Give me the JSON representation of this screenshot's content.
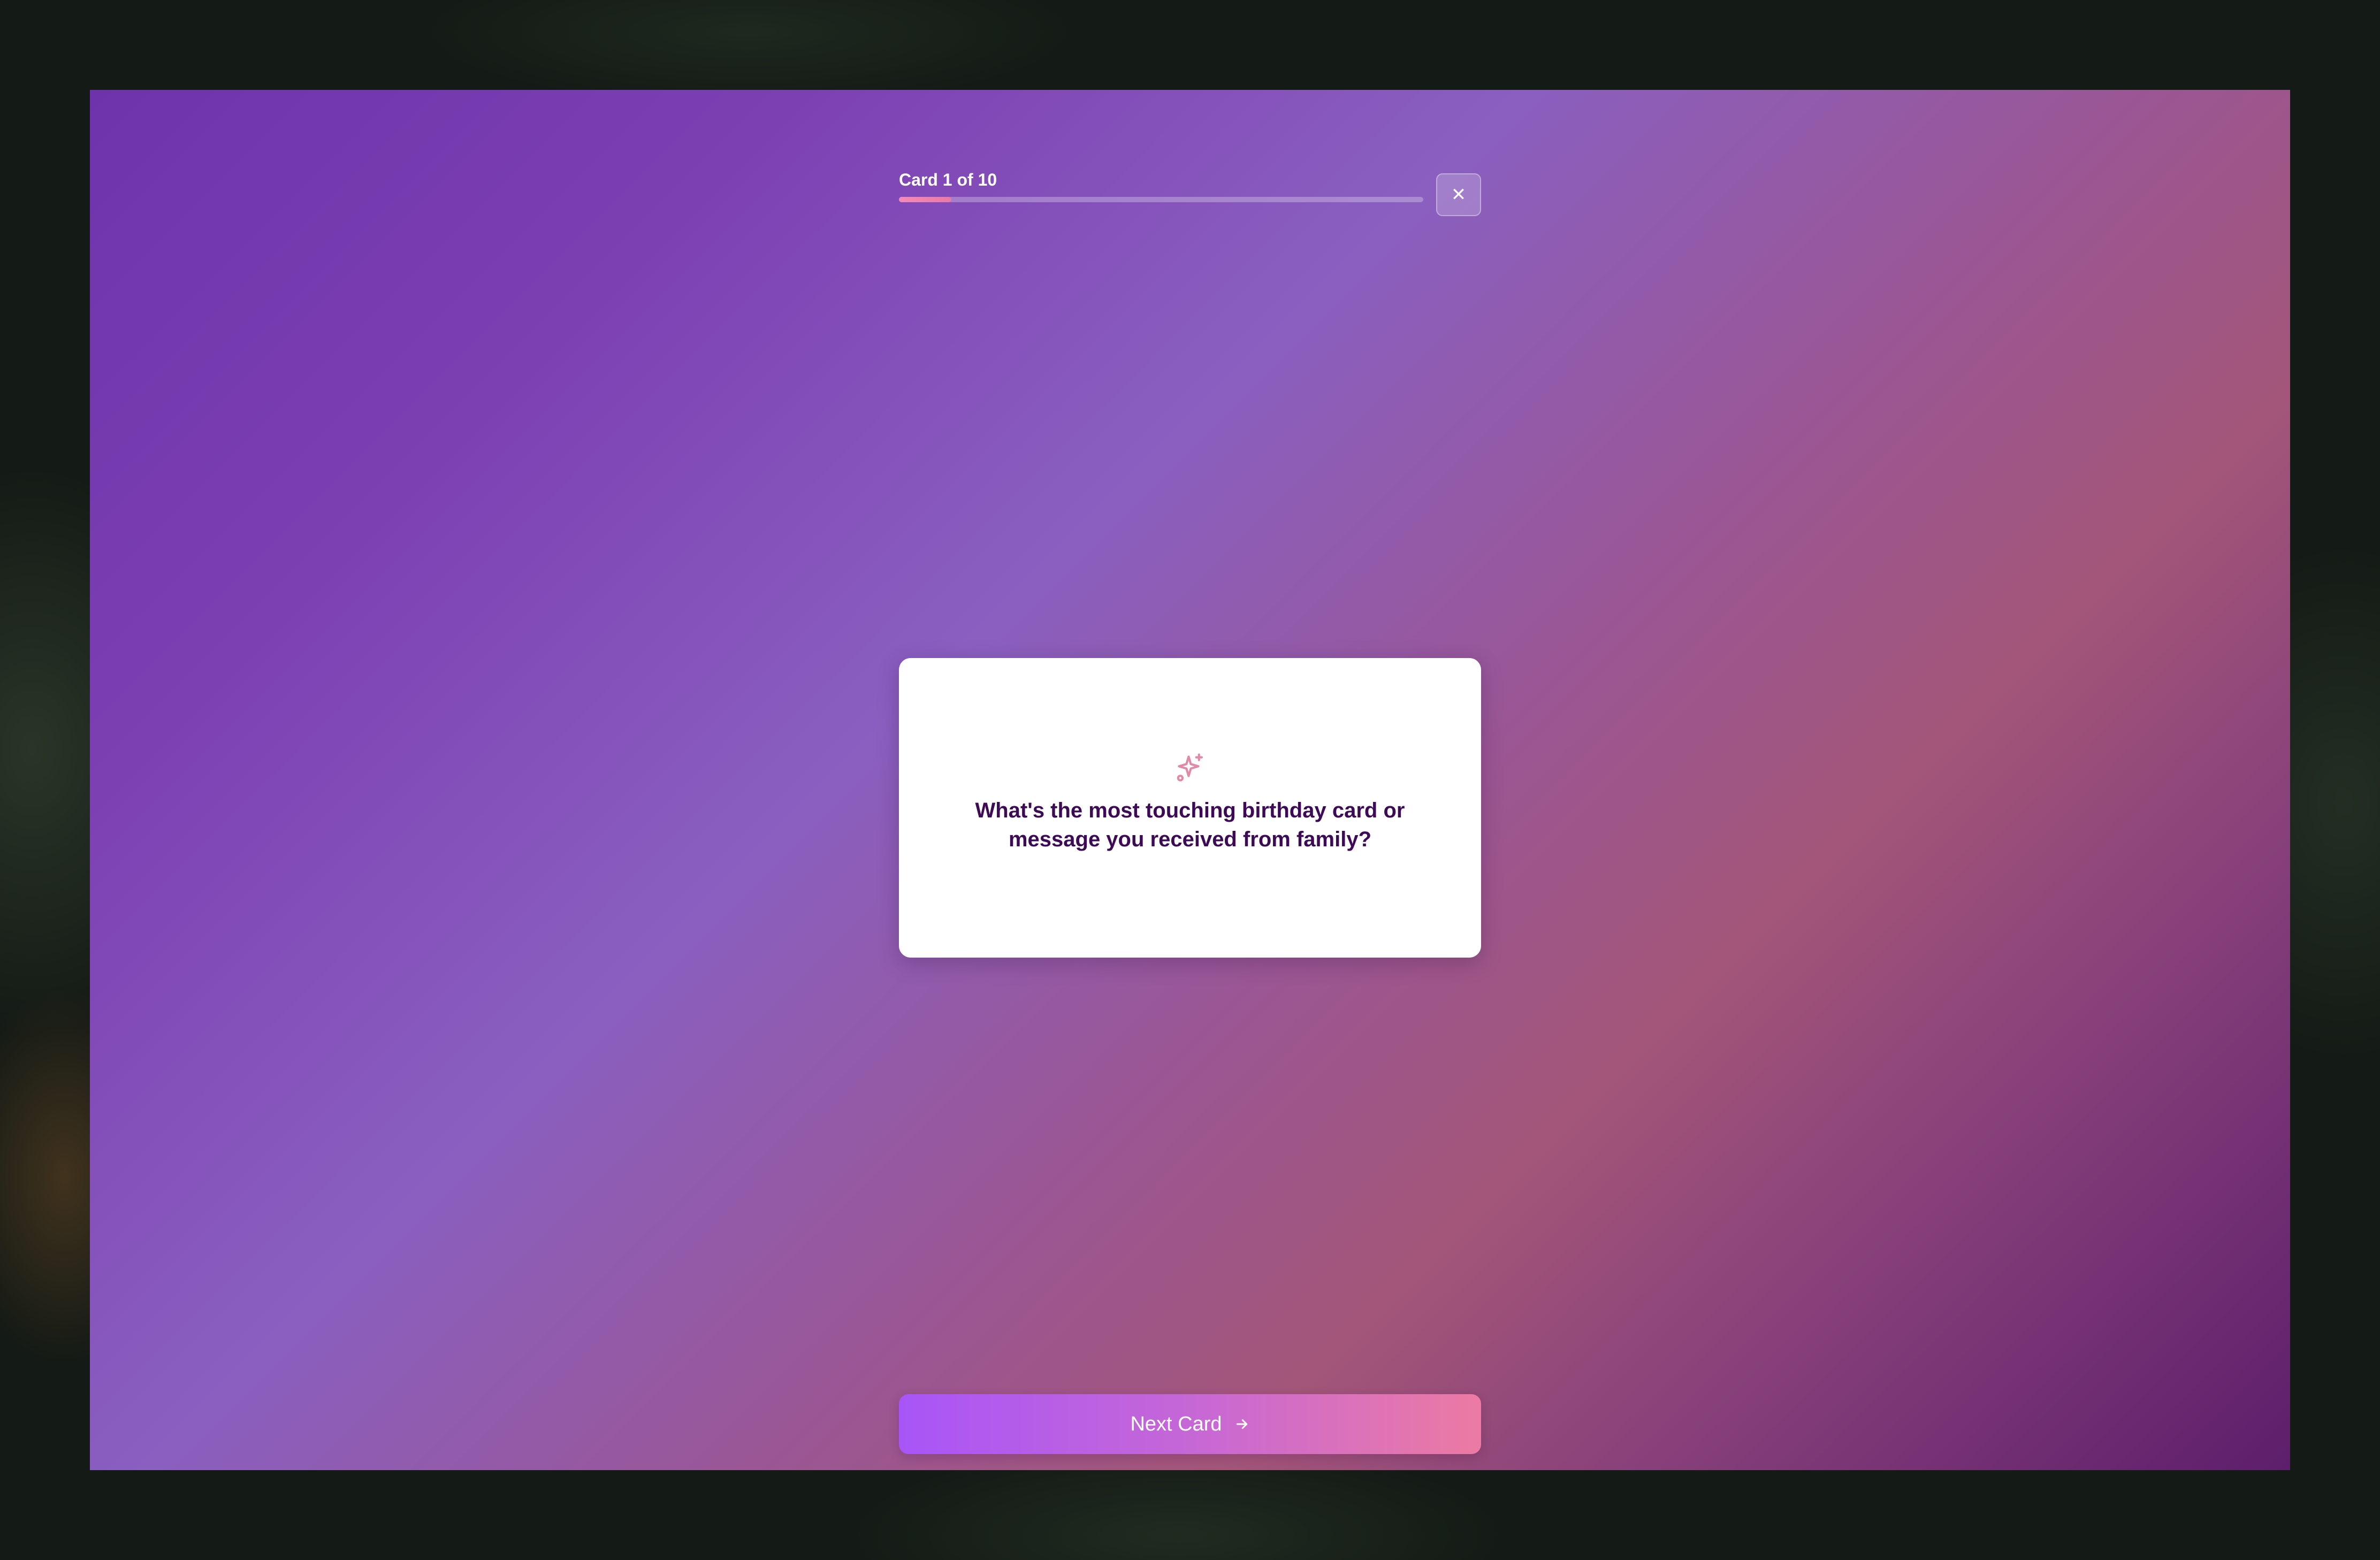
{
  "header": {
    "card_counter": "Card 1 of 10",
    "progress_fraction": 0.1,
    "close_icon": "close-icon",
    "close_glyph": "✕"
  },
  "card": {
    "icon": "sparkle-icon",
    "question": "What's the most touching birthday card or message you received from family?"
  },
  "footer": {
    "next_label": "Next Card",
    "next_icon": "arrow-right-icon"
  },
  "colors": {
    "question_text": "#3d0a55",
    "sparkle": "#e08aa8",
    "progress_fill": "#e879a8",
    "button_start": "#a855f7",
    "button_end": "#ec7aa3"
  }
}
